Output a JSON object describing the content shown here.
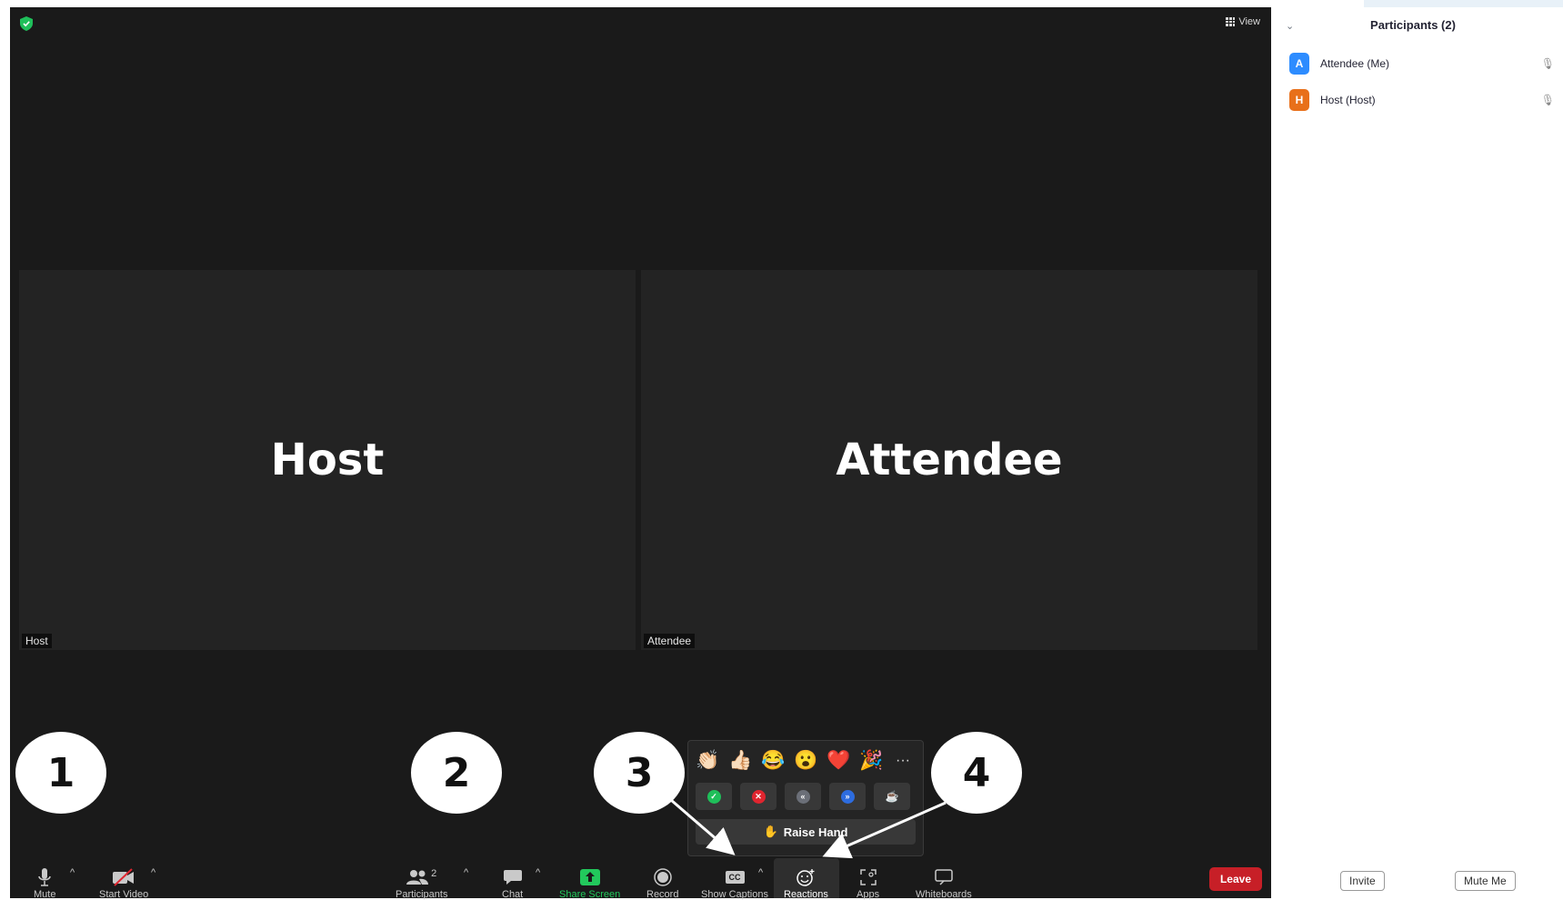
{
  "meeting": {
    "view_label": "View",
    "tiles": [
      {
        "name": "Host",
        "label": "Host"
      },
      {
        "name": "Attendee",
        "label": "Attendee"
      }
    ],
    "toolbar": {
      "mute": "Mute",
      "start_video": "Start Video",
      "participants": "Participants",
      "participants_count": "2",
      "chat": "Chat",
      "share_screen": "Share Screen",
      "record": "Record",
      "show_captions": "Show Captions",
      "captions_icon_text": "CC",
      "reactions": "Reactions",
      "apps": "Apps",
      "whiteboards": "Whiteboards",
      "leave": "Leave"
    },
    "reactions_popup": {
      "emojis": [
        "👏🏻",
        "👍🏻",
        "😂",
        "😮",
        "❤️",
        "🎉"
      ],
      "more_label": "···",
      "raise_hand": "Raise Hand",
      "raise_hand_icon": "✋"
    },
    "callouts": [
      "1",
      "2",
      "3",
      "4"
    ]
  },
  "participants_panel": {
    "title": "Participants (2)",
    "participants": [
      {
        "initial": "A",
        "name": "Attendee (Me)",
        "color": "#2d8cff"
      },
      {
        "initial": "H",
        "name": "Host (Host)",
        "color": "#e8701a"
      }
    ],
    "invite": "Invite",
    "mute_me": "Mute Me"
  },
  "colors": {
    "meeting_bg": "#1a1a1a",
    "tile_bg": "#232323",
    "share_green": "#22c95c",
    "leave_red": "#c71f27"
  }
}
